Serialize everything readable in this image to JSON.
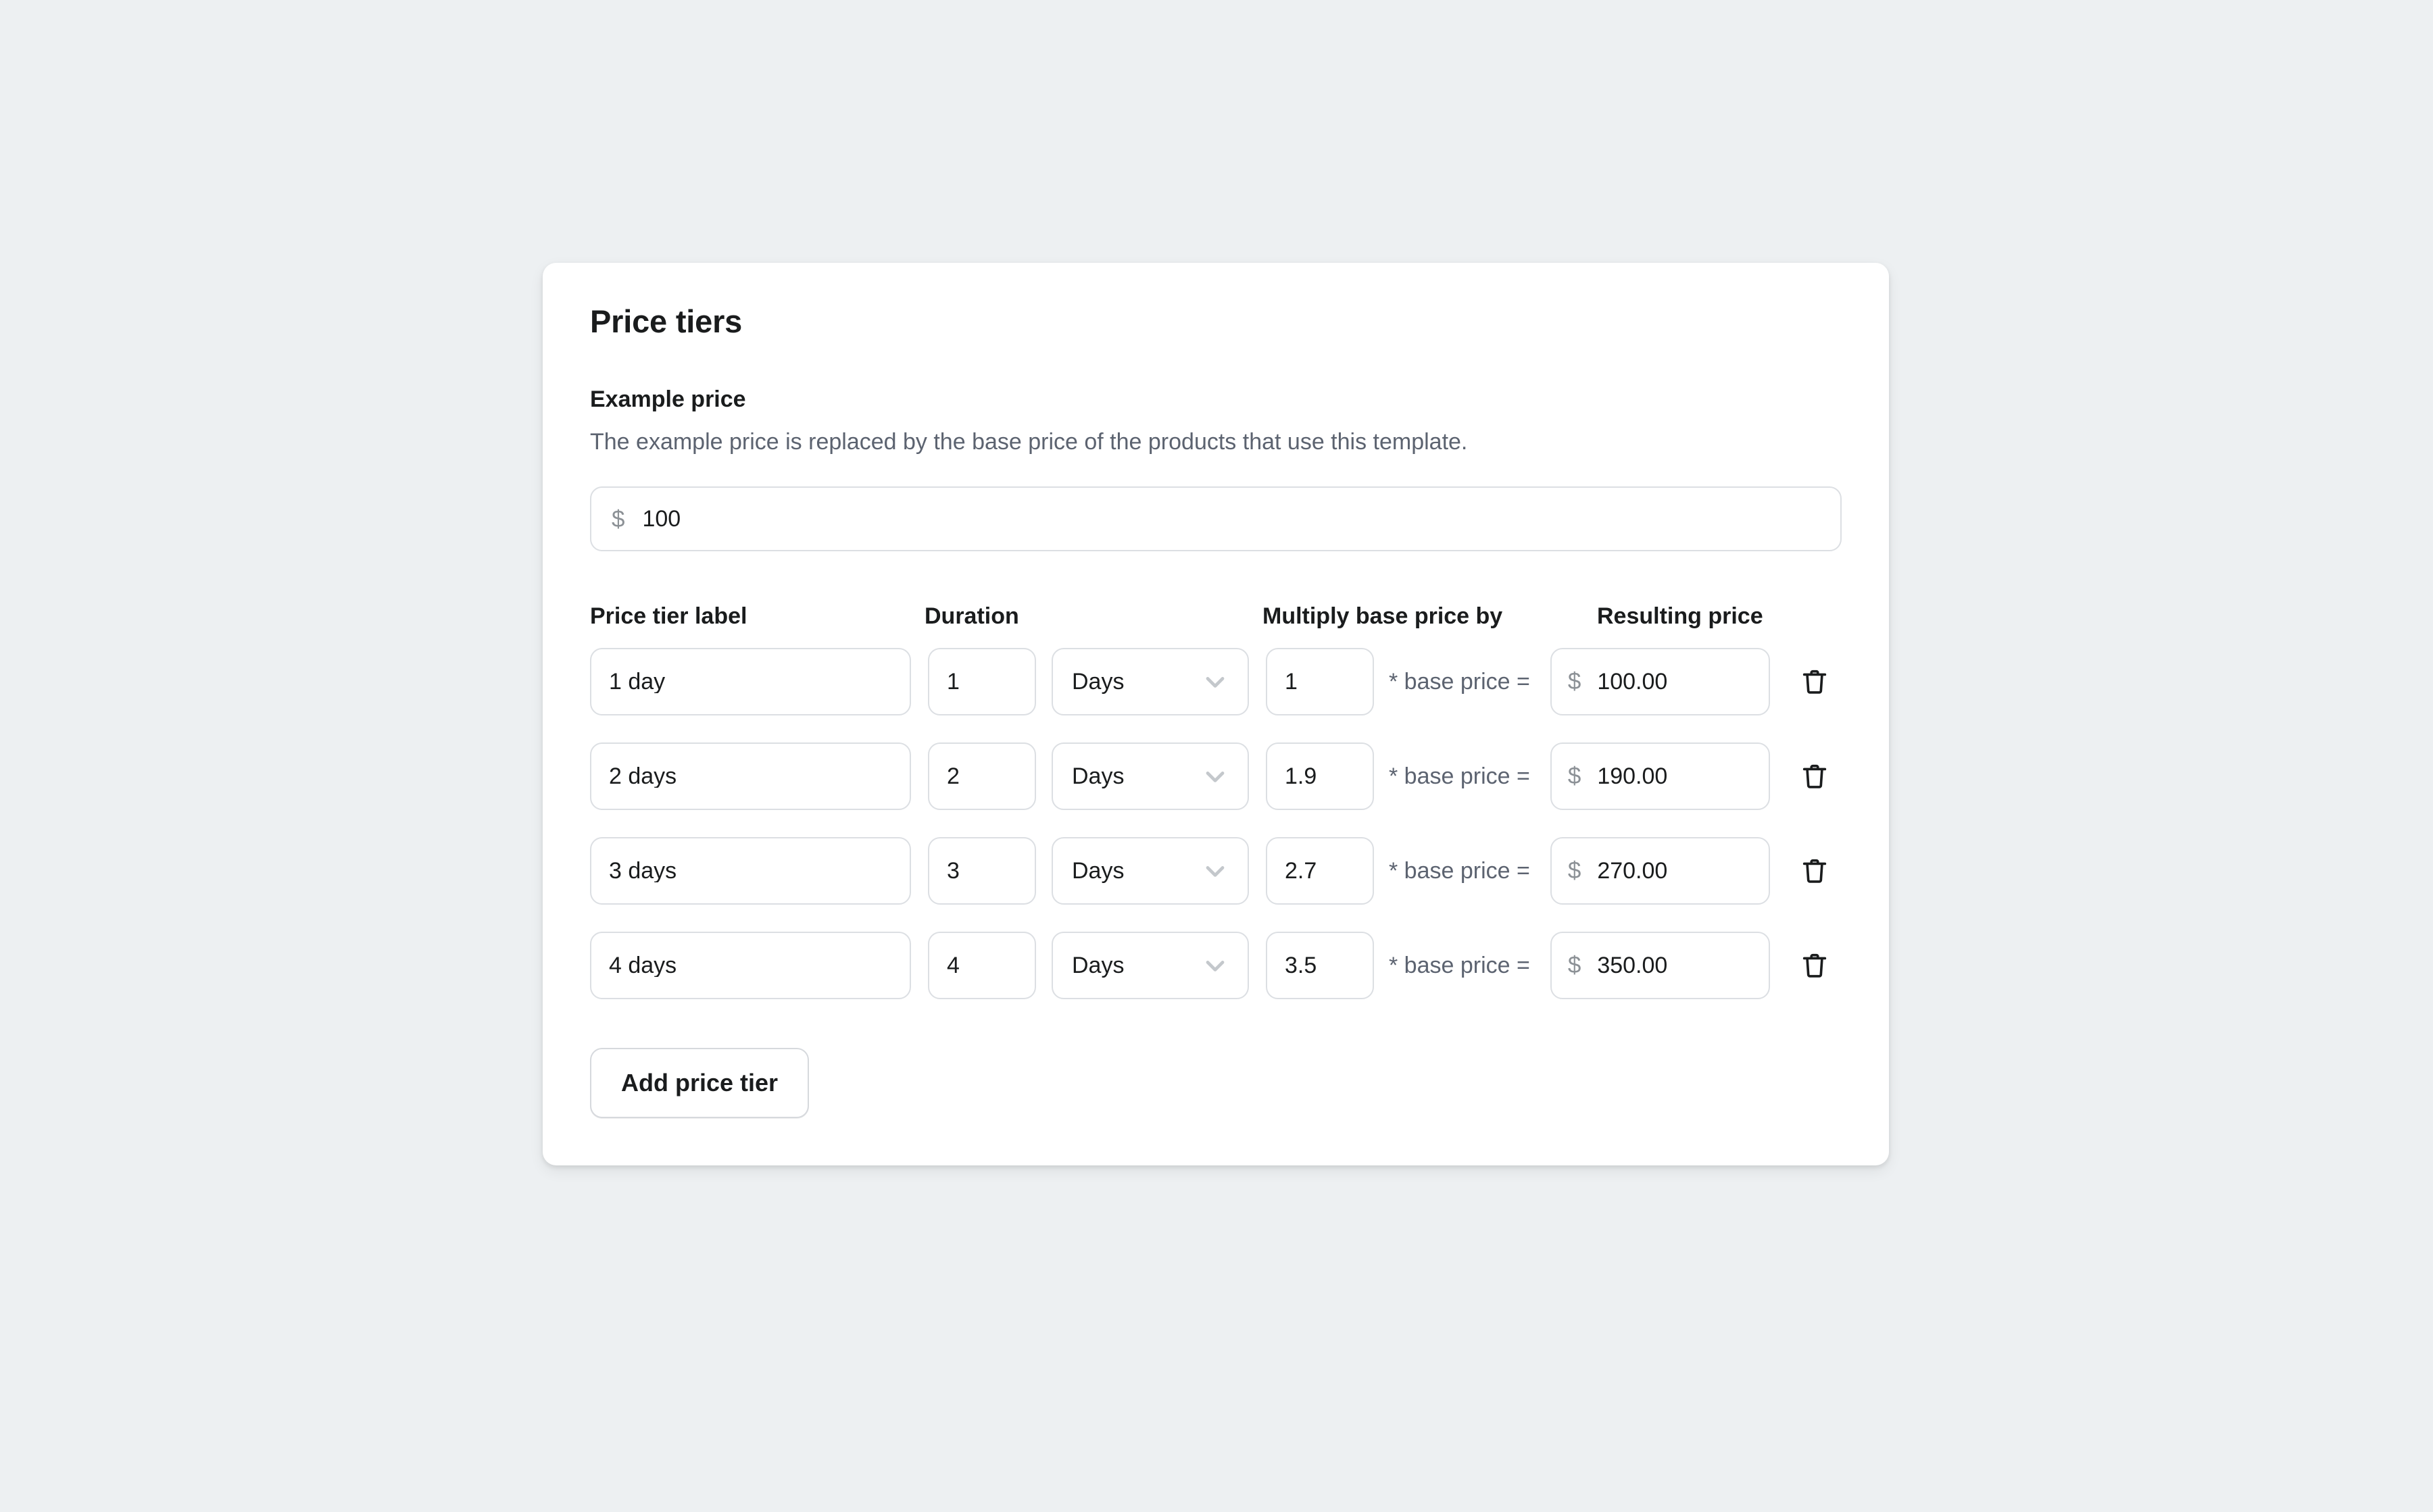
{
  "card": {
    "title": "Price tiers"
  },
  "example_price": {
    "label": "Example price",
    "help": "The example price is replaced by the base price of the products that use this template.",
    "currency_symbol": "$",
    "value": "100"
  },
  "table": {
    "headers": {
      "label": "Price tier label",
      "duration": "Duration",
      "multiply": "Multiply base price by",
      "result": "Resulting price"
    },
    "formula_text": "* base price =",
    "currency_symbol": "$",
    "rows": [
      {
        "label": "1 day",
        "duration": "1",
        "unit": "Days",
        "multiplier": "1",
        "formula": "* base price =",
        "result": "100.00"
      },
      {
        "label": "2 days",
        "duration": "2",
        "unit": "Days",
        "multiplier": "1.9",
        "formula": "* base price =",
        "result": "190.00"
      },
      {
        "label": "3 days",
        "duration": "3",
        "unit": "Days",
        "multiplier": "2.7",
        "formula": "* base price =",
        "result": "270.00"
      },
      {
        "label": "4 days",
        "duration": "4",
        "unit": "Days",
        "multiplier": "3.5",
        "formula": "* base price =",
        "result": "350.00"
      }
    ]
  },
  "actions": {
    "add_price_tier": "Add price tier"
  },
  "icons": {
    "chevron_down": "chevron-down-icon",
    "trash": "trash-icon"
  },
  "colors": {
    "page_background": "#edf0f2",
    "card_background": "#ffffff",
    "text_primary": "#1a1c1d",
    "text_secondary": "#5c6370",
    "border": "#dcdfe3",
    "icon_muted": "#c4c8cc"
  }
}
